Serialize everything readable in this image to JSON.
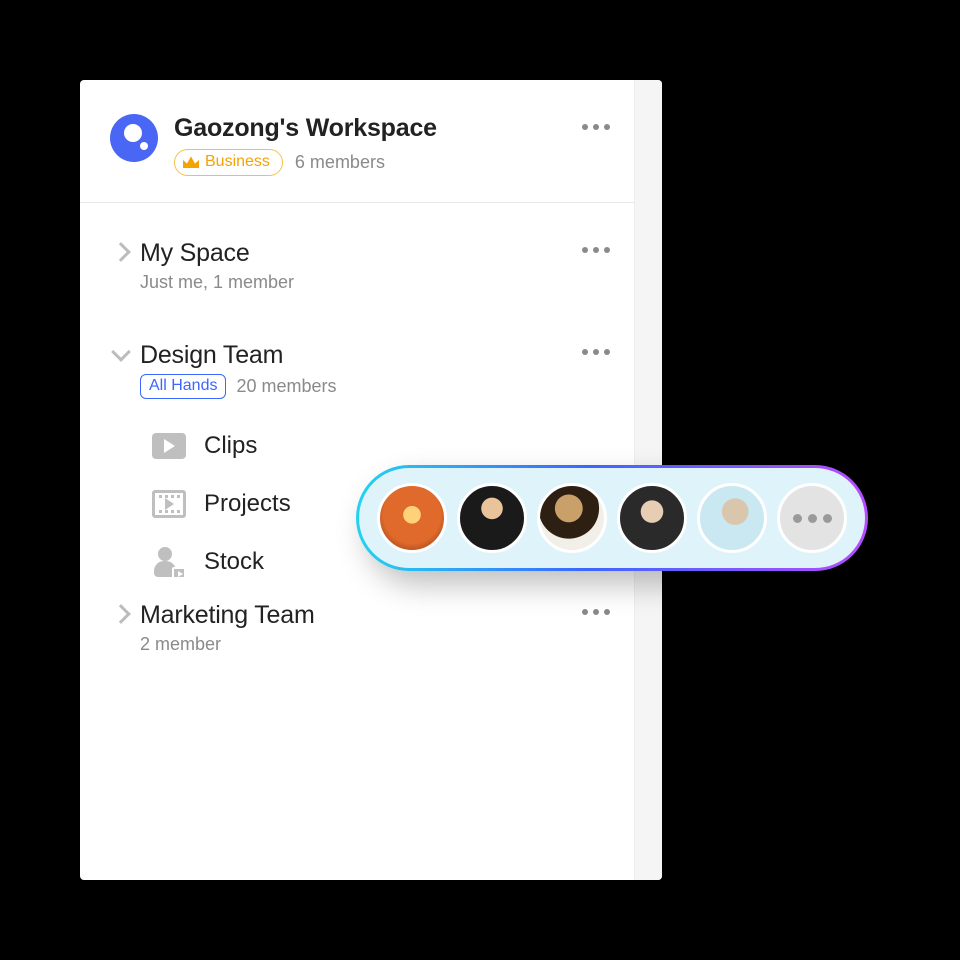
{
  "workspace": {
    "title": "Gaozong's Workspace",
    "plan_label": "Business",
    "members_text": "6 members"
  },
  "spaces": [
    {
      "name": "My Space",
      "sub": "Just me, 1 member",
      "expanded": false
    },
    {
      "name": "Design Team",
      "tag": "All Hands",
      "members": "20 members",
      "expanded": true,
      "children": [
        {
          "icon": "clips-icon",
          "label": "Clips"
        },
        {
          "icon": "projects-icon",
          "label": "Projects"
        },
        {
          "icon": "stock-icon",
          "label": "Stock"
        }
      ]
    },
    {
      "name": "Marketing Team",
      "sub": "2 member",
      "expanded": false
    }
  ],
  "member_pill": {
    "visible_count": 5,
    "has_overflow": true
  }
}
